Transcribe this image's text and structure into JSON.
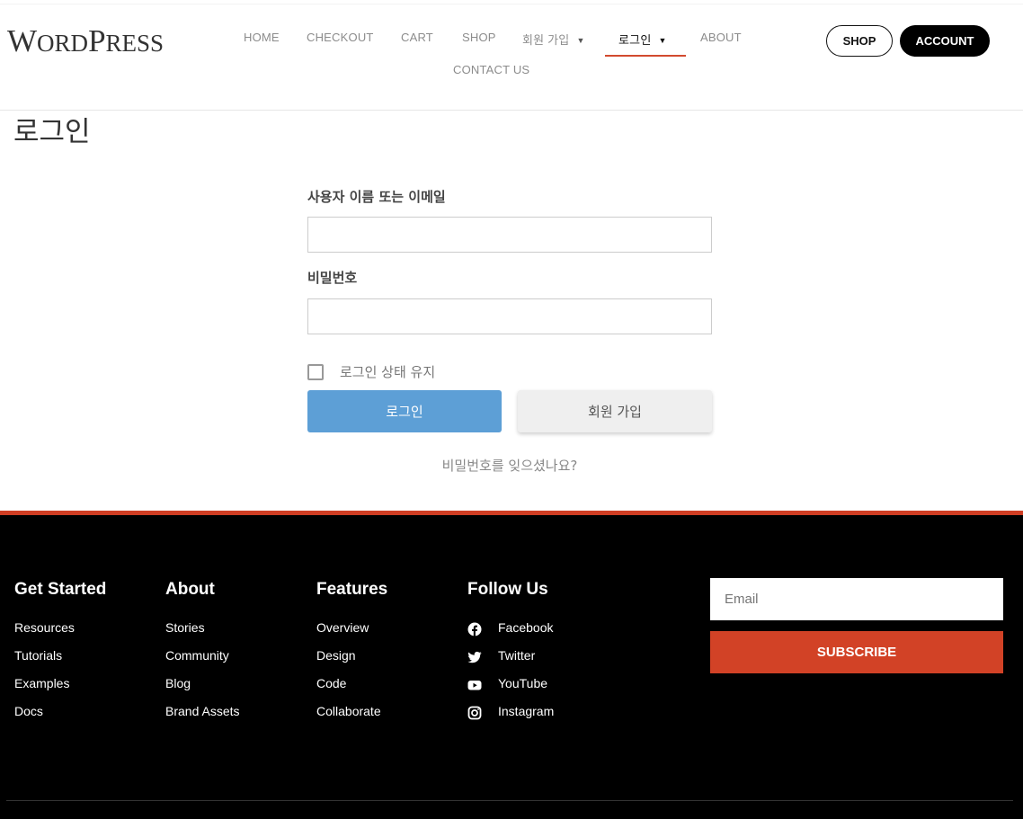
{
  "header": {
    "logo": {
      "big_w": "W",
      "small_1": "ORD",
      "big_p": "P",
      "small_2": "RESS"
    },
    "nav": [
      {
        "label": "HOME"
      },
      {
        "label": "CHECKOUT"
      },
      {
        "label": "CART"
      },
      {
        "label": "SHOP"
      },
      {
        "label": "회원 가입",
        "has_dropdown": true
      },
      {
        "label": "로그인",
        "has_dropdown": true,
        "active": true
      },
      {
        "label": "ABOUT"
      },
      {
        "label": "CONTACT US"
      }
    ],
    "caret": "▼",
    "shop_button": "SHOP",
    "account_button": "ACCOUNT"
  },
  "page_title": "로그인",
  "form": {
    "username_label": "사용자 이름 또는 이메일",
    "username_value": "",
    "password_label": "비밀번호",
    "password_value": "",
    "remember_label": "로그인 상태 유지",
    "remember_checked": false,
    "login_button": "로그인",
    "register_button": "회원 가입",
    "forgot_link": "비밀번호를 잊으셨나요?"
  },
  "footer": {
    "columns": [
      {
        "title": "Get Started",
        "links": [
          "Resources",
          "Tutorials",
          "Examples",
          "Docs"
        ]
      },
      {
        "title": "About",
        "links": [
          "Stories",
          "Community",
          "Blog",
          "Brand Assets"
        ]
      },
      {
        "title": "Features",
        "links": [
          "Overview",
          "Design",
          "Code",
          "Collaborate"
        ]
      },
      {
        "title": "Follow Us",
        "links": [
          "Facebook",
          "Twitter",
          "YouTube",
          "Instagram"
        ],
        "icons": [
          "facebook-icon",
          "twitter-icon",
          "youtube-icon",
          "instagram-icon"
        ]
      }
    ],
    "email_placeholder": "Email",
    "subscribe_button": "SUBSCRIBE"
  },
  "colors": {
    "accent": "#d24a2f",
    "login_button": "#5d9fd6",
    "footer_bg": "#000000",
    "subscribe_bg": "#d24226"
  }
}
